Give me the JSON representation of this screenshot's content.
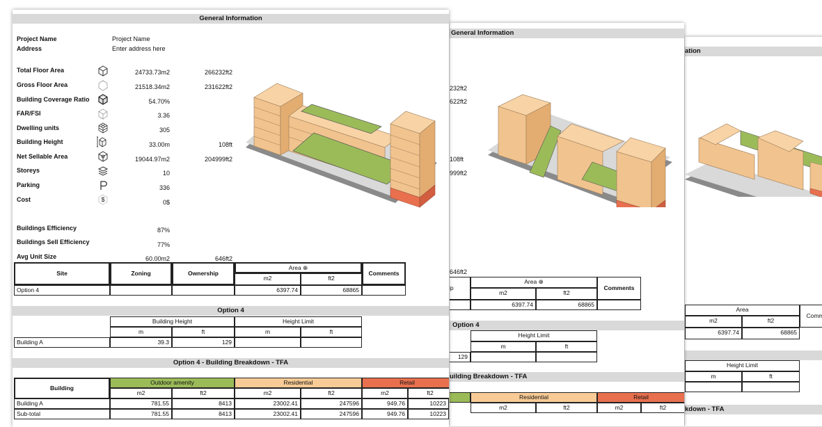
{
  "general_header": "General Information",
  "general_header_partial_3": "ation",
  "fields": {
    "project_name": {
      "label": "Project Name",
      "value": "Project Name"
    },
    "address": {
      "label": "Address",
      "value": "Enter address here"
    }
  },
  "metrics": [
    {
      "label": "Total Floor Area",
      "icon": "cube-icon",
      "m": "24733.73m2",
      "ft": "266232ft2"
    },
    {
      "label": "Gross Floor Area",
      "icon": "cube-outline-icon",
      "m": "21518.34m2",
      "ft": "231622ft2"
    },
    {
      "label": "Building Coverage Ratio",
      "icon": "cube-coverage-icon",
      "m": "54.70%",
      "ft": ""
    },
    {
      "label": "FAR/FSI",
      "icon": "cube-dotted-icon",
      "m": "3.36",
      "ft": ""
    },
    {
      "label": "Dwelling units",
      "icon": "grid-cube-icon",
      "m": "305",
      "ft": ""
    },
    {
      "label": "Building Height",
      "icon": "height-cube-icon",
      "m": "33.00m",
      "ft": "108ft"
    },
    {
      "label": "Net Sellable Area",
      "icon": "cube-net-icon",
      "m": "19044.97m2",
      "ft": "204999ft2"
    },
    {
      "label": "Storeys",
      "icon": "layers-icon",
      "m": "10",
      "ft": ""
    },
    {
      "label": "Parking",
      "icon": "parking-icon",
      "m": "336",
      "ft": ""
    },
    {
      "label": "Cost",
      "icon": "cost-icon",
      "m": "0$",
      "ft": ""
    }
  ],
  "efficiency": [
    {
      "label": "Buildings Efficiency",
      "value": "87%"
    },
    {
      "label": "Buildings Sell Efficiency",
      "value": "77%"
    },
    {
      "label": "Avg Unit Size",
      "value": "60.00m2",
      "ft": "646ft2"
    }
  ],
  "site_table": {
    "headers": {
      "site": "Site",
      "zoning": "Zoning",
      "ownership": "Ownership",
      "area": "Area",
      "m2": "m2",
      "ft2": "ft2",
      "comments": "Comments"
    },
    "row": {
      "site": "Option 4",
      "m2": "6397.74",
      "ft2": "68865"
    }
  },
  "option_header": "Option 4",
  "option_header_partial_2": "Option 4",
  "height_table": {
    "building_height": "Building Height",
    "height_limit": "Height Limit",
    "m": "m",
    "ft": "ft",
    "row": {
      "name": "Building A",
      "m": "39.3",
      "ft": "129"
    }
  },
  "breakdown_header": "Option 4 - Building Breakdown - TFA",
  "breakdown_header_partial_2": "uilding Breakdown - TFA",
  "breakdown_header_partial_3": "kdown - TFA",
  "breakdown_table": {
    "building": "Building",
    "outdoor": "Outdoor amenity",
    "residential": "Residential",
    "retail": "Retail",
    "m2": "m2",
    "ft2": "ft2",
    "rows": [
      {
        "name": "Building A",
        "o_m2": "781.55",
        "o_ft2": "8413",
        "r_m2": "23002.41",
        "r_ft2": "247596",
        "t_m2": "949.76",
        "t_ft2": "10223"
      },
      {
        "name": "Sub-total",
        "o_m2": "781.55",
        "o_ft2": "8413",
        "r_m2": "23002.41",
        "r_ft2": "247596",
        "t_m2": "949.76",
        "t_ft2": "10223"
      }
    ]
  },
  "partial_text": {
    "s2_ft2_1": "232ft2",
    "s2_ft2_2": "622ft2",
    "s2_ft": "108ft",
    "s2_ft2_3": "999ft2",
    "s2_avg": "646ft2",
    "s2_site_frag": "ip",
    "s2_ft_129": "129"
  },
  "colors": {
    "outdoor": "#9bbb59",
    "residential": "#f8cb96",
    "retail": "#e8704f",
    "header_gray": "#d9d9d9"
  }
}
